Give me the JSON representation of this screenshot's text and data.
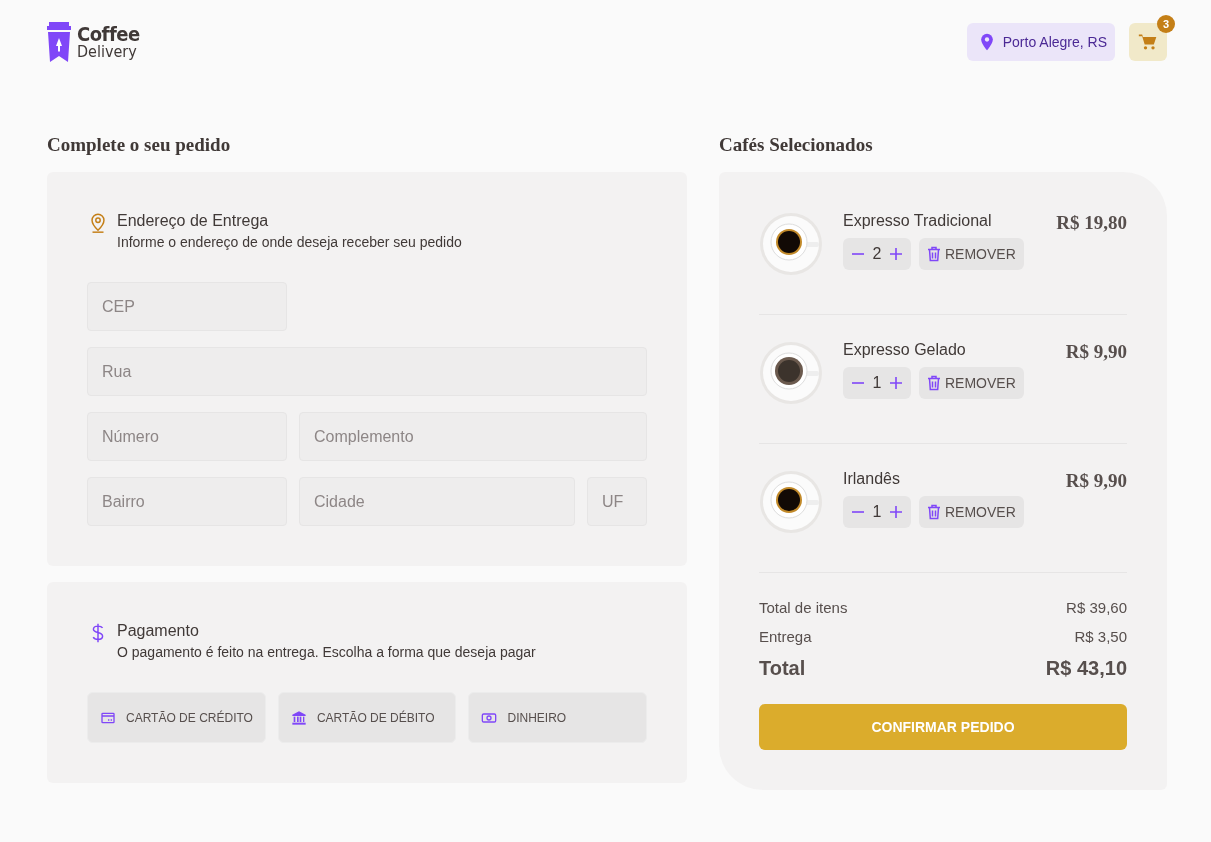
{
  "header": {
    "logo": {
      "line_1": "Coffee",
      "line_2": "Delivery"
    },
    "location": "Porto Alegre, RS",
    "cart_count": "3"
  },
  "order_form": {
    "title": "Complete o seu pedido",
    "address": {
      "title": "Endereço de Entrega",
      "subtitle": "Informe o endereço de onde deseja receber seu pedido",
      "rows": [
        [
          {
            "placeholder": "CEP",
            "kind": "short"
          }
        ],
        [
          {
            "placeholder": "Rua",
            "kind": "grow"
          }
        ],
        [
          {
            "placeholder": "Número",
            "kind": "short"
          },
          {
            "placeholder": "Complemento",
            "kind": "grow"
          }
        ],
        [
          {
            "placeholder": "Bairro",
            "kind": "short"
          },
          {
            "placeholder": "Cidade",
            "kind": "grow"
          },
          {
            "placeholder": "UF",
            "kind": "tiny"
          }
        ]
      ]
    },
    "payment": {
      "title": "Pagamento",
      "subtitle": "O pagamento é feito na entrega. Escolha a forma que deseja pagar",
      "options": [
        {
          "label": "CARTÃO DE CRÉDITO",
          "kind": "credit",
          "selected": false
        },
        {
          "label": "CARTÃO DE DÉBITO",
          "kind": "debit",
          "selected": false
        },
        {
          "label": "DINHEIRO",
          "kind": "cash",
          "selected": false
        }
      ]
    }
  },
  "cart": {
    "title": "Cafés Selecionados",
    "items": [
      {
        "name": "Expresso Tradicional",
        "quantity": "2",
        "remove": "REMOVER",
        "price": "R$ 19,80",
        "kind": "black"
      },
      {
        "name": "Expresso Gelado",
        "quantity": "1",
        "remove": "REMOVER",
        "price": "R$ 9,90",
        "kind": "iced"
      },
      {
        "name": "Irlandês",
        "quantity": "1",
        "remove": "REMOVER",
        "price": "R$ 9,90",
        "kind": "black"
      }
    ],
    "summary": [
      {
        "label": "Total de itens",
        "value": "R$ 39,60",
        "kind": "normal"
      },
      {
        "label": "Entrega",
        "value": "R$ 3,50",
        "kind": "normal"
      },
      {
        "label": "Total",
        "value": "R$ 43,10",
        "kind": "total"
      }
    ],
    "confirm": "CONFIRMAR PEDIDO"
  }
}
